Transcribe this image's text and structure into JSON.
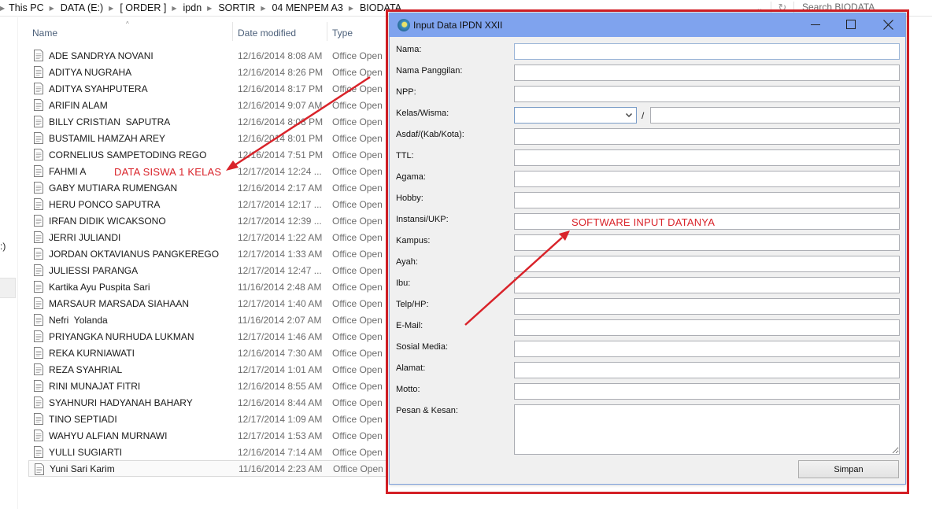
{
  "explorer": {
    "breadcrumb": [
      "This PC",
      "DATA (E:)",
      "[ ORDER ]",
      "ipdn",
      "SORTIR",
      "04 MENPEM A3",
      "BIODATA"
    ],
    "search_placeholder": "Search BIODATA",
    "nav_pane_fragment": ":)",
    "columns": {
      "name": "Name",
      "date": "Date modified",
      "type": "Type"
    },
    "files": [
      {
        "name": "ADE SANDRYA NOVANI",
        "date": "12/16/2014 8:08 AM",
        "type": "Office Open"
      },
      {
        "name": "ADITYA NUGRAHA",
        "date": "12/16/2014 8:26 PM",
        "type": "Office Open"
      },
      {
        "name": "ADITYA SYAHPUTERA",
        "date": "12/16/2014 8:17 PM",
        "type": "Office Open"
      },
      {
        "name": "ARIFIN ALAM",
        "date": "12/16/2014 9:07 AM",
        "type": "Office Open"
      },
      {
        "name": "BILLY CRISTIAN  SAPUTRA",
        "date": "12/16/2014 8:08 PM",
        "type": "Office Open"
      },
      {
        "name": "BUSTAMIL HAMZAH AREY",
        "date": "12/16/2014 8:01 PM",
        "type": "Office Open"
      },
      {
        "name": "CORNELIUS SAMPETODING REGO",
        "date": "12/16/2014 7:51 PM",
        "type": "Office Open"
      },
      {
        "name": "FAHMI A",
        "date": "12/17/2014 12:24 ...",
        "type": "Office Open"
      },
      {
        "name": "GABY MUTIARA RUMENGAN",
        "date": "12/16/2014 2:17 AM",
        "type": "Office Open"
      },
      {
        "name": "HERU PONCO SAPUTRA",
        "date": "12/17/2014 12:17 ...",
        "type": "Office Open"
      },
      {
        "name": "IRFAN DIDIK WICAKSONO",
        "date": "12/17/2014 12:39 ...",
        "type": "Office Open"
      },
      {
        "name": "JERRI JULIANDI",
        "date": "12/17/2014 1:22 AM",
        "type": "Office Open"
      },
      {
        "name": "JORDAN OKTAVIANUS PANGKEREGO",
        "date": "12/17/2014 1:33 AM",
        "type": "Office Open"
      },
      {
        "name": "JULIESSI PARANGA",
        "date": "12/17/2014 12:47 ...",
        "type": "Office Open"
      },
      {
        "name": "Kartika Ayu Puspita Sari",
        "date": "11/16/2014 2:48 AM",
        "type": "Office Open"
      },
      {
        "name": "MARSAUR MARSADA SIAHAAN",
        "date": "12/17/2014 1:40 AM",
        "type": "Office Open"
      },
      {
        "name": "Nefri  Yolanda",
        "date": "11/16/2014 2:07 AM",
        "type": "Office Open"
      },
      {
        "name": "PRIYANGKA NURHUDA LUKMAN",
        "date": "12/17/2014 1:46 AM",
        "type": "Office Open"
      },
      {
        "name": "REKA KURNIAWATI",
        "date": "12/16/2014 7:30 AM",
        "type": "Office Open"
      },
      {
        "name": "REZA SYAHRIAL",
        "date": "12/17/2014 1:01 AM",
        "type": "Office Open"
      },
      {
        "name": "RINI MUNAJAT FITRI",
        "date": "12/16/2014 8:55 AM",
        "type": "Office Open"
      },
      {
        "name": "SYAHNURI HADYANAH BAHARY",
        "date": "12/16/2014 8:44 AM",
        "type": "Office Open"
      },
      {
        "name": "TINO SEPTIADI",
        "date": "12/17/2014 1:09 AM",
        "type": "Office Open"
      },
      {
        "name": "WAHYU ALFIAN MURNAWI",
        "date": "12/17/2014 1:53 AM",
        "type": "Office Open"
      },
      {
        "name": "YULLI SUGIARTI",
        "date": "12/16/2014 7:14 AM",
        "type": "Office Open"
      },
      {
        "name": "Yuni Sari Karim",
        "date": "11/16/2014 2:23 AM",
        "type": "Office Open",
        "selected": true
      }
    ]
  },
  "annotations": {
    "left": "DATA SISWA 1 KELAS",
    "right": "SOFTWARE INPUT DATANYA",
    "color": "#d9232a"
  },
  "dialog": {
    "title": "Input Data IPDN XXII",
    "fields": {
      "nama": {
        "label": "Nama:",
        "value": ""
      },
      "nama_panggilan": {
        "label": "Nama Panggilan:",
        "value": ""
      },
      "npp": {
        "label": "NPP:",
        "value": ""
      },
      "kelas_wisma": {
        "label": "Kelas/Wisma:",
        "kelas_value": "",
        "separator": "/",
        "wisma_value": ""
      },
      "asdaf": {
        "label": "Asdaf/(Kab/Kota):",
        "value": ""
      },
      "ttl": {
        "label": "TTL:",
        "value": ""
      },
      "agama": {
        "label": "Agama:",
        "value": ""
      },
      "hobby": {
        "label": "Hobby:",
        "value": ""
      },
      "instansi": {
        "label": "Instansi/UKP:",
        "value": ""
      },
      "kampus": {
        "label": "Kampus:",
        "value": ""
      },
      "ayah": {
        "label": "Ayah:",
        "value": ""
      },
      "ibu": {
        "label": "Ibu:",
        "value": ""
      },
      "telp": {
        "label": "Telp/HP:",
        "value": ""
      },
      "email": {
        "label": "E-Mail:",
        "value": ""
      },
      "sosmed": {
        "label": "Sosial Media:",
        "value": ""
      },
      "alamat": {
        "label": "Alamat:",
        "value": ""
      },
      "motto": {
        "label": "Motto:",
        "value": ""
      },
      "pesan_kesan": {
        "label": "Pesan & Kesan:",
        "value": ""
      }
    },
    "save_label": "Simpan",
    "titlebar_color": "#7fa3ee",
    "highlight_color": "#d41f26"
  }
}
